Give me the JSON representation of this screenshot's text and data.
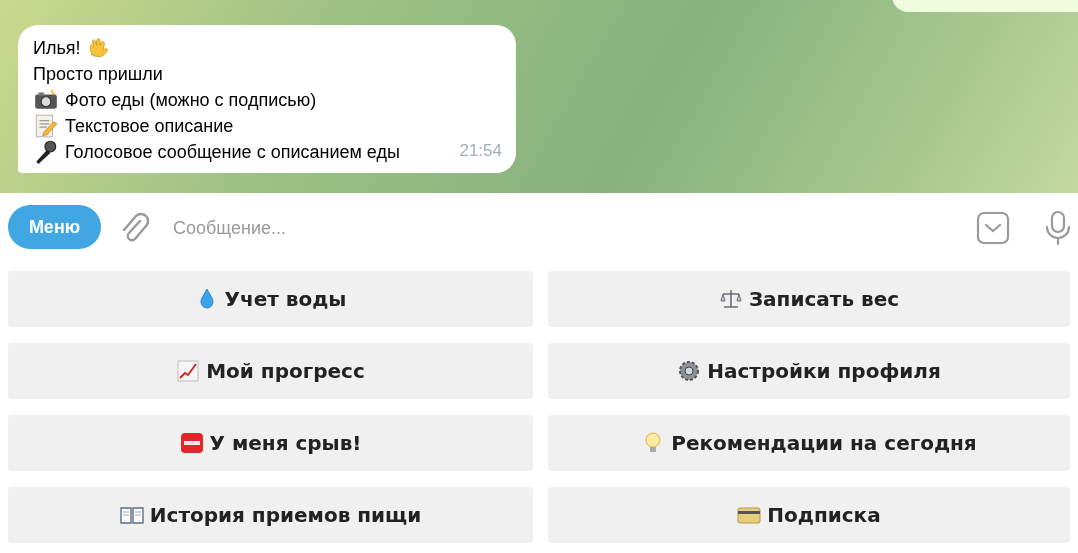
{
  "message": {
    "lines": [
      "Илья!",
      "Просто пришли",
      "Фото еды (можно с подписью)",
      "Текстовое описание",
      "Голосовое сообщение с описанием еды"
    ],
    "time": "21:54"
  },
  "composer": {
    "menu_button": "Меню",
    "placeholder": "Сообщение..."
  },
  "keyboard": [
    {
      "label": "Учет воды"
    },
    {
      "label": "Записать вес"
    },
    {
      "label": "Мой прогресс"
    },
    {
      "label": "Настройки профиля"
    },
    {
      "label": "У меня срыв!"
    },
    {
      "label": "Рекомендации на сегодня"
    },
    {
      "label": "История приемов пищи"
    },
    {
      "label": "Подписка"
    }
  ]
}
